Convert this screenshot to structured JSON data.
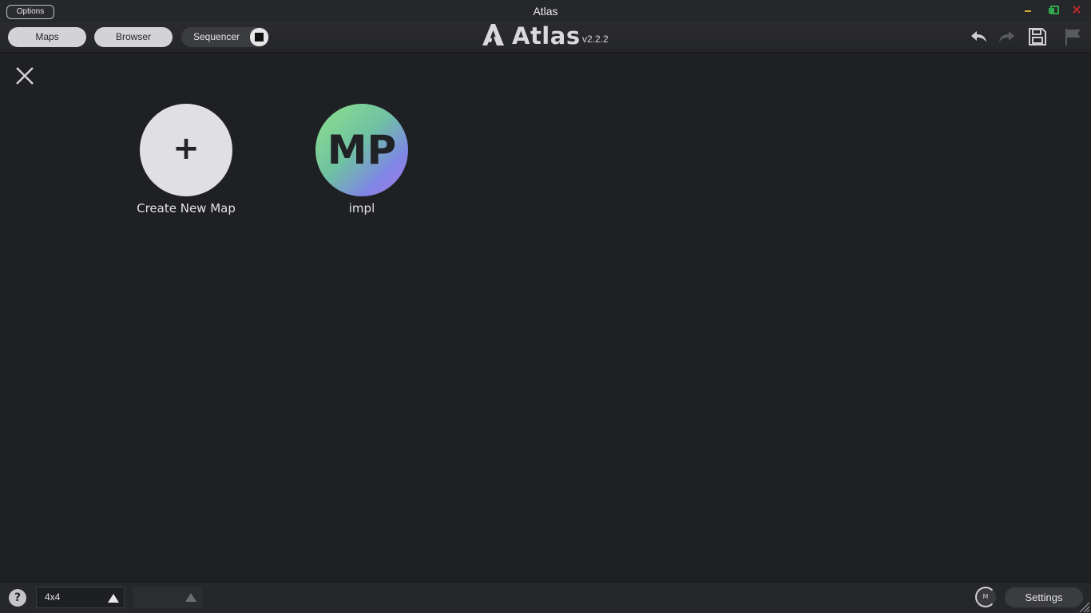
{
  "window": {
    "title": "Atlas",
    "options_label": "Options"
  },
  "toolbar": {
    "tabs": [
      {
        "label": "Maps"
      },
      {
        "label": "Browser"
      }
    ],
    "sequencer_label": "Sequencer",
    "logo_word": "Atlas",
    "version": "v2.2.2",
    "icons": [
      "undo-icon",
      "redo-icon",
      "save-icon",
      "flag-icon"
    ]
  },
  "main": {
    "tiles": [
      {
        "label": "Create New Map",
        "symbol": "+"
      },
      {
        "label": "impl",
        "initials": "MP"
      }
    ]
  },
  "statusbar": {
    "help": "?",
    "grid_size": "4x4",
    "knob_label": "M",
    "settings_label": "Settings"
  },
  "colors": {
    "background": "#1f2024",
    "titlebar": "#26272b",
    "pill_light": "#d3d3d5",
    "minimize": "#d2b03b",
    "maximize": "#2ea84a",
    "close": "#b62a2a"
  }
}
